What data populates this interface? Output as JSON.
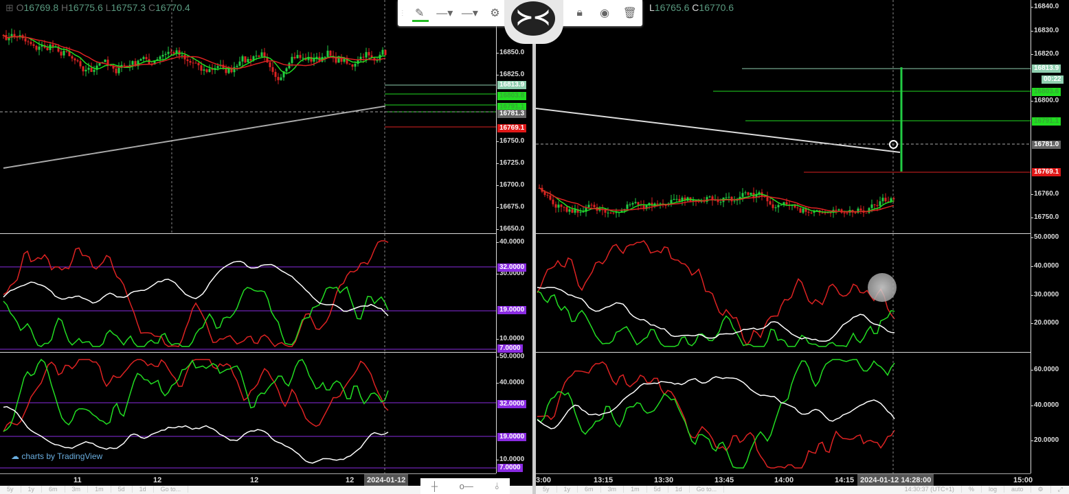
{
  "left_chart": {
    "ohlc": {
      "o": "16769.8",
      "h": "16775.6",
      "l": "16757.3",
      "c": "16770.4"
    },
    "price_ticks": [
      "16850.0",
      "16825.0",
      "16750.0",
      "16725.0",
      "16700.0",
      "16675.0",
      "16650.0"
    ],
    "price_tags": [
      {
        "text": "16813.9",
        "bg": "#8fd0b0"
      },
      {
        "text": "16803.8",
        "bg": "#22dd22"
      },
      {
        "text": "16791.1",
        "bg": "#22dd22"
      },
      {
        "text": "16781.3",
        "bg": "#666666"
      },
      {
        "text": "16769.1",
        "bg": "#e01818"
      }
    ],
    "osc1_ticks": [
      "40.0000",
      "30.0000",
      "10.0000"
    ],
    "osc1_tags": [
      "32.0000",
      "19.0000",
      "7.0000"
    ],
    "osc2_ticks": [
      "50.0000",
      "40.0000",
      "10.0000"
    ],
    "osc2_tags": [
      "32.0000",
      "19.0000",
      "7.0000"
    ],
    "time_labels": [
      "11",
      "12",
      "12",
      "12"
    ],
    "time_selected": "2024-01-12",
    "watermark": "charts by TradingView",
    "range_buttons": [
      "5y",
      "1y",
      "6m",
      "3m",
      "1m",
      "5d",
      "1d",
      "Go to..."
    ]
  },
  "right_chart": {
    "ohlc": {
      "l": "16765.6",
      "c": "16770.6"
    },
    "price_ticks": [
      "16840.0",
      "16830.0",
      "16820.0",
      "16800.0",
      "16760.0",
      "16750.0"
    ],
    "price_tags": [
      {
        "text": "16813.9",
        "bg": "#8fd0b0"
      },
      {
        "text": "00:22",
        "bg": "#8fd0b0"
      },
      {
        "text": "16803.6",
        "bg": "#22dd22"
      },
      {
        "text": "16791.1",
        "bg": "#22dd22"
      },
      {
        "text": "16781.0",
        "bg": "#666666"
      },
      {
        "text": "16769.1",
        "bg": "#e01818"
      }
    ],
    "osc1_ticks": [
      "50.0000",
      "40.0000",
      "30.0000",
      "20.0000"
    ],
    "osc2_ticks": [
      "60.0000",
      "40.0000",
      "20.0000"
    ],
    "time_labels": [
      "3:00",
      "13:15",
      "13:30",
      "13:45",
      "14:00",
      "14:15",
      "15:00"
    ],
    "time_selected": "2024-01-12 14:28:00",
    "range_buttons": [
      "5y",
      "1y",
      "6m",
      "3m",
      "1m",
      "5d",
      "1d",
      "Go to..."
    ],
    "clock": "14:30:37 (UTC+1)",
    "scale_buttons": [
      "%",
      "log",
      "auto"
    ]
  },
  "drawing_toolbar": {
    "tools": [
      "pencil-icon",
      "line-style-icon",
      "line-width-icon",
      "gear-icon",
      "lock-icon",
      "eye-icon",
      "trash-icon"
    ],
    "accent": "#22bb22"
  },
  "colors": {
    "up": "#22cc44",
    "down": "#dd2222",
    "ma_green": "#22dd22",
    "ma_red": "#dd2222",
    "ma_gray": "#aaaaaa",
    "level": "#8a2be2"
  }
}
